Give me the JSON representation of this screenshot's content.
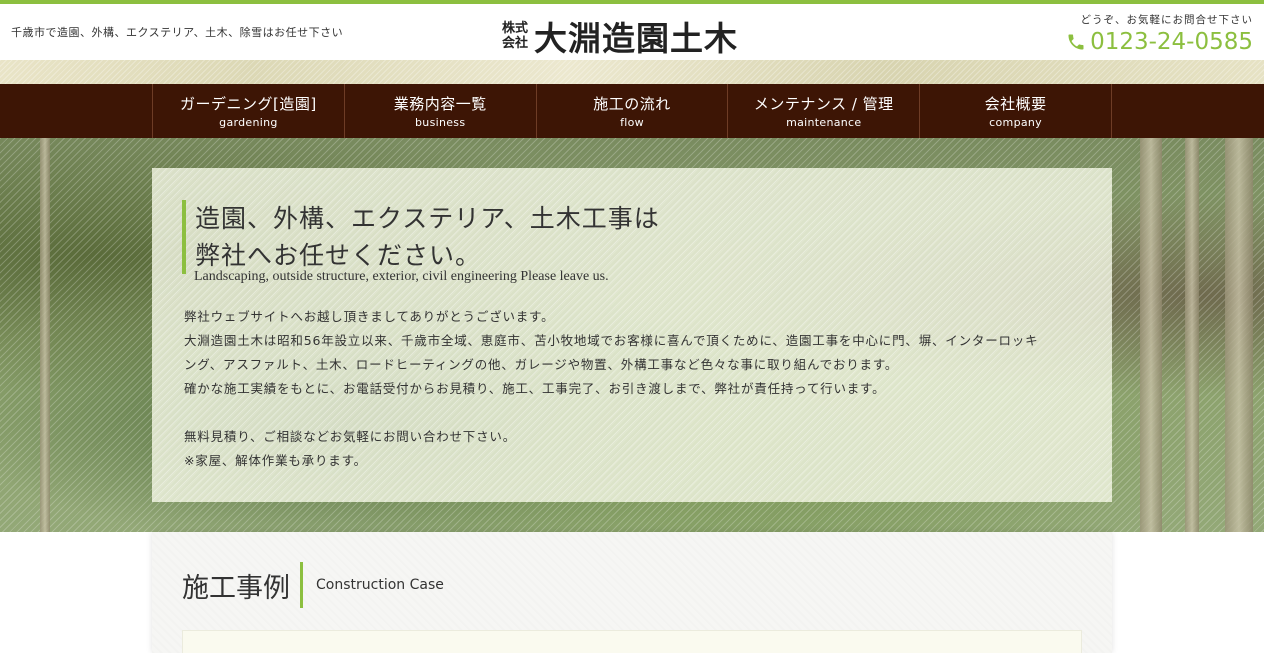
{
  "header": {
    "tagline": "千歳市で造園、外構、エクステリア、土木、除雪はお任せ下さい",
    "logo": {
      "kabushiki_top": "株式",
      "kabushiki_bottom": "会社",
      "name": "大淵造園土木"
    },
    "contact": {
      "note": "どうぞ、お気軽にお問合せ下さい",
      "phone": "0123-24-0585",
      "icon": "phone-icon"
    }
  },
  "nav": {
    "items": [
      {
        "jp": "ガーデニング[造園]",
        "en": "gardening"
      },
      {
        "jp": "業務内容一覧",
        "en": "business"
      },
      {
        "jp": "施工の流れ",
        "en": "flow"
      },
      {
        "jp": "メンテナンス / 管理",
        "en": "maintenance"
      },
      {
        "jp": "会社概要",
        "en": "company"
      }
    ]
  },
  "hero": {
    "title_line1": "造園、外構、エクステリア、土木工事は",
    "title_line2": "弊社へお任せください。",
    "subtitle": "Landscaping, outside structure, exterior, civil engineering Please leave us.",
    "body": [
      "弊社ウェブサイトへお越し頂きましてありがとうございます。",
      "大淵造園土木は昭和56年設立以来、千歳市全域、恵庭市、苫小牧地域でお客様に喜んで頂くために、造園工事を中心に門、塀、インターロッキ",
      "ング、アスファルト、土木、ロードヒーティングの他、ガレージや物置、外構工事など色々な事に取り組んでおります。",
      "確かな施工実績をもとに、お電話受付からお見積り、施工、工事完了、お引き渡しまで、弊社が責任持って行います。",
      "",
      "無料見積り、ご相談などお気軽にお問い合わせ下さい。",
      "※家屋、解体作業も承ります。"
    ]
  },
  "section": {
    "title_jp": "施工事例",
    "title_en": "Construction Case"
  },
  "colors": {
    "accent": "#8cbf3f",
    "nav_bg": "#3d1505"
  }
}
